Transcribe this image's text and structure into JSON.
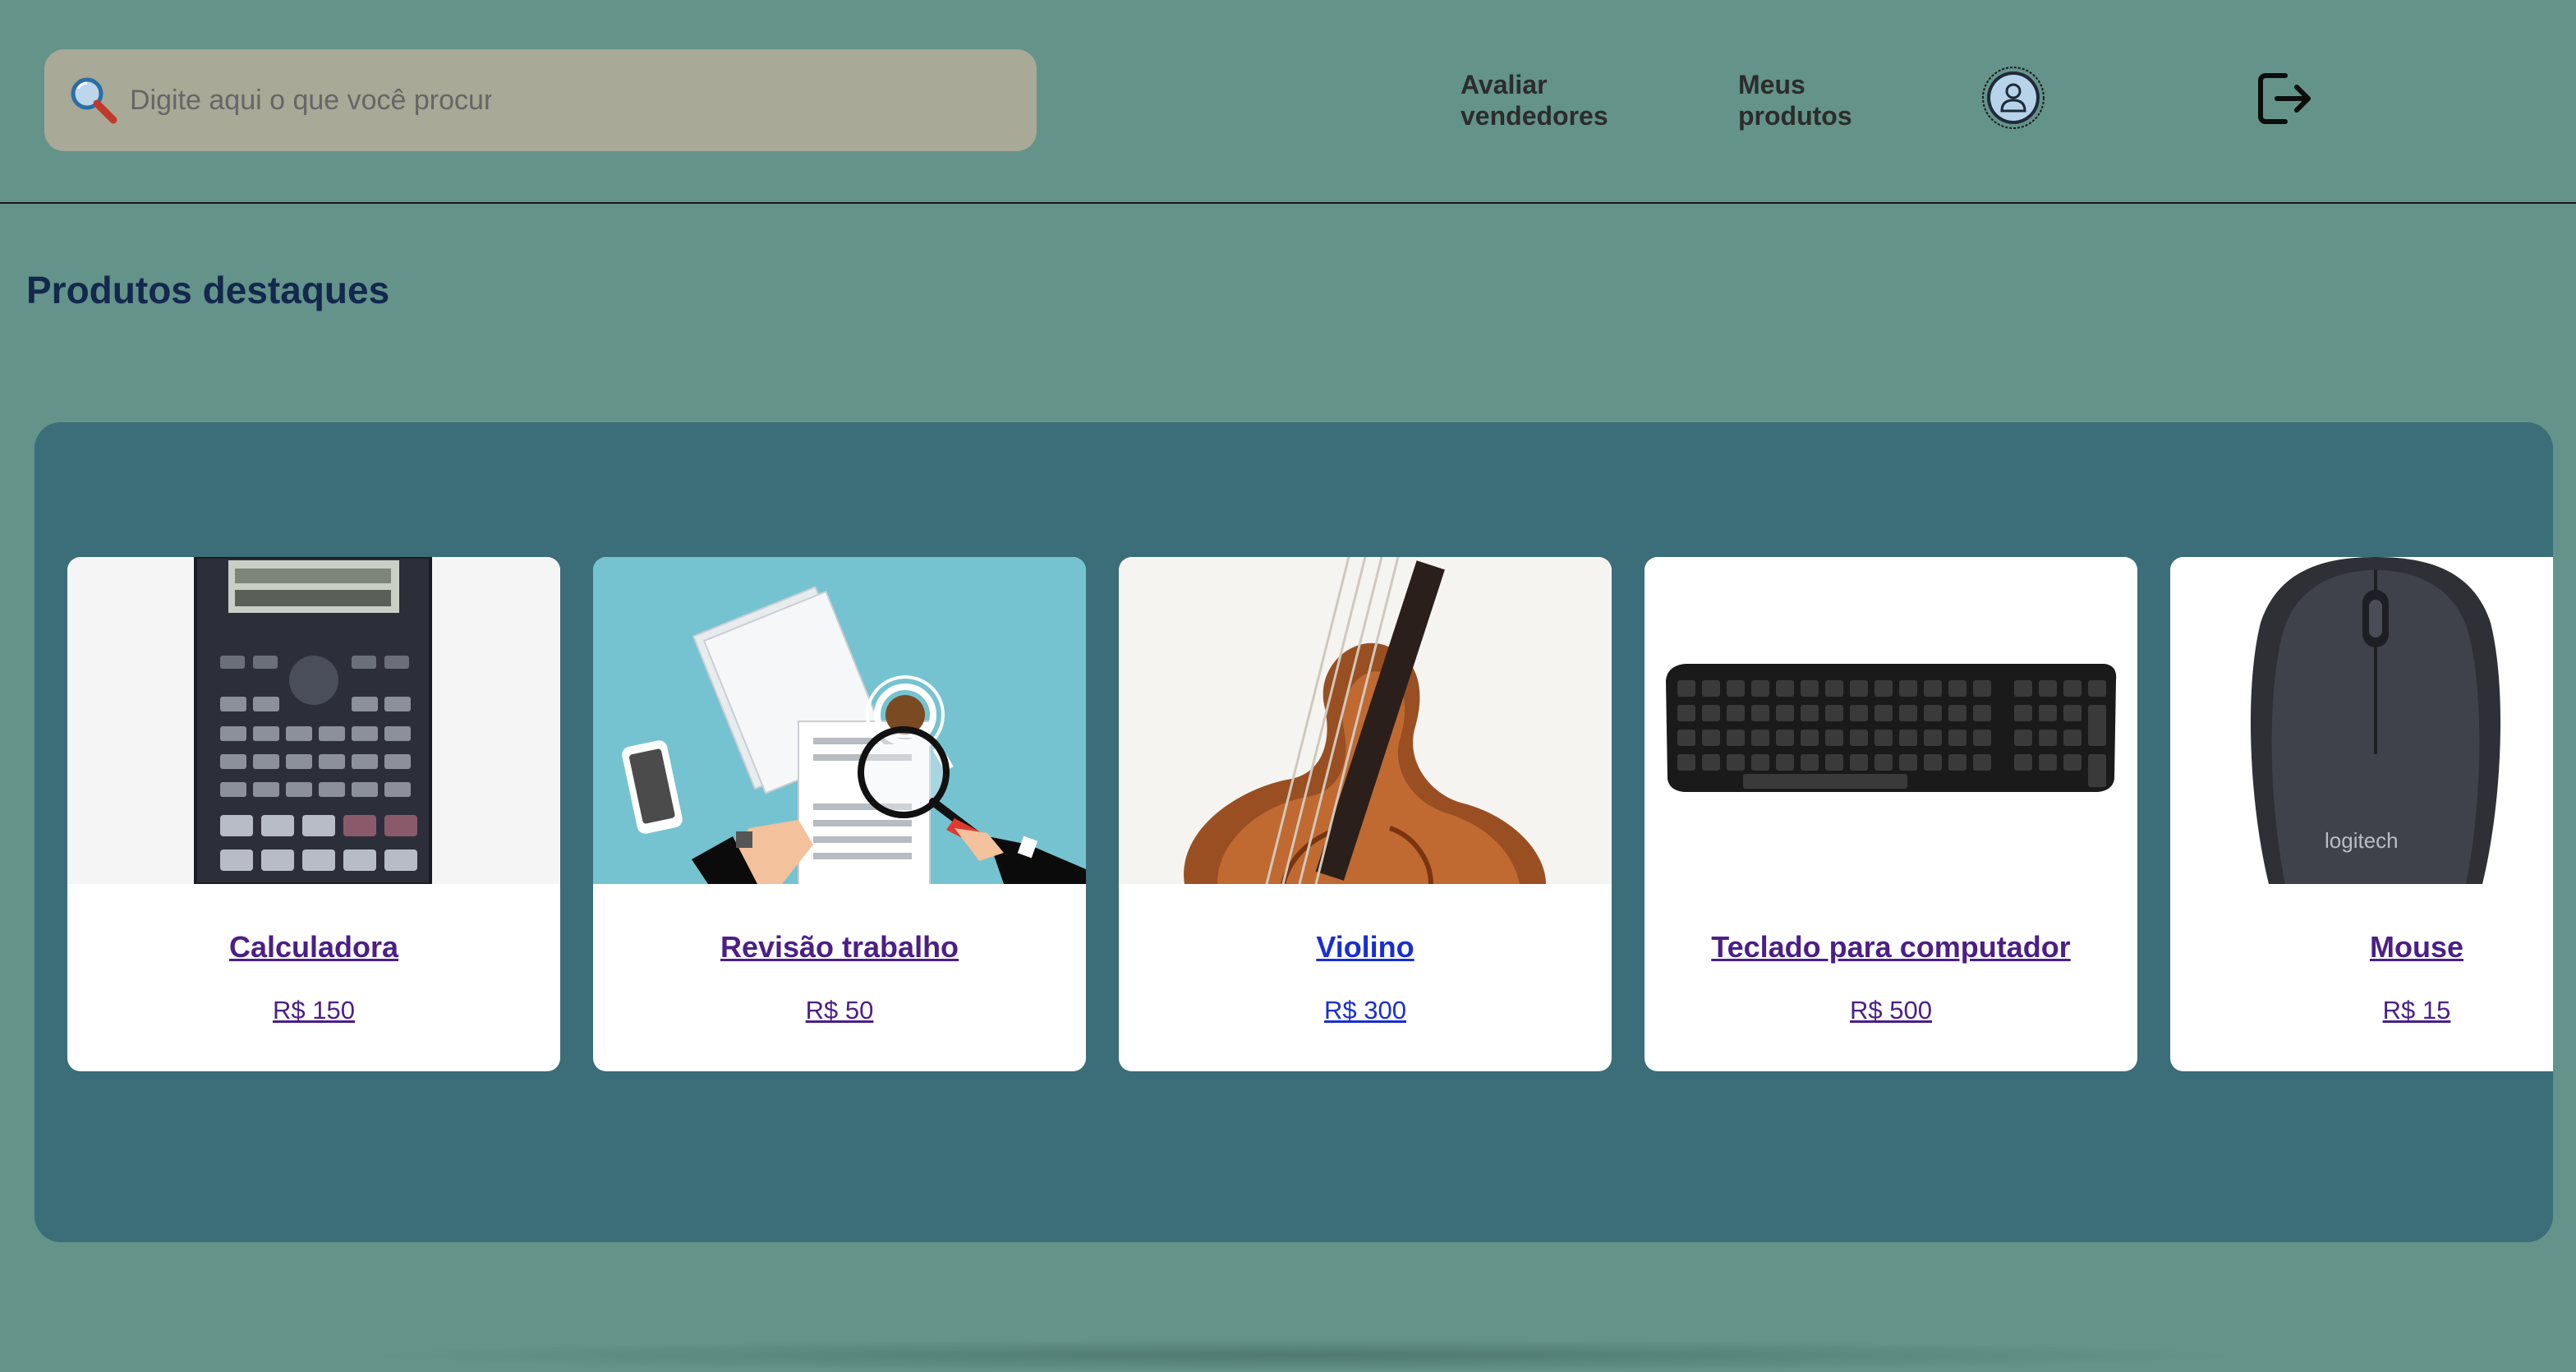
{
  "header": {
    "search_placeholder": "Digite aqui o que você procura",
    "nav": {
      "rate_sellers": "Avaliar vendedores",
      "my_products": "Meus produtos"
    },
    "icons": {
      "search": "search-icon",
      "profile": "user-icon",
      "logout": "logout-icon"
    }
  },
  "main": {
    "section_title": "Produtos destaques",
    "products": [
      {
        "name": "Calculadora",
        "price": "R$ 150"
      },
      {
        "name": "Revisão trabalho",
        "price": "R$ 50"
      },
      {
        "name": "Violino",
        "price": "R$ 300"
      },
      {
        "name": "Teclado para computador",
        "price": "R$ 500"
      },
      {
        "name": "Mouse",
        "price": "R$ 15"
      }
    ]
  },
  "colors": {
    "page_bg": "#64938a",
    "search_bg": "#a8a996",
    "carousel_bg": "#3b6e78",
    "title": "#13284d",
    "visited_link": "#4b1f86",
    "link": "#1a2fd0"
  }
}
